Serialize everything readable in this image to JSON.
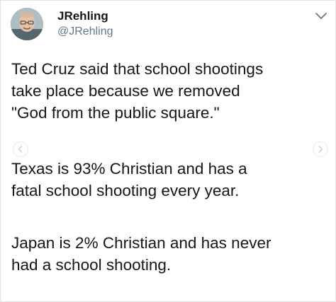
{
  "tweet": {
    "author_name": "JRehling",
    "author_handle": "@JRehling",
    "paragraphs": [
      [
        "Ted Cruz said that school shootings",
        "take place because we removed",
        "\"God from the public square.\""
      ],
      [
        "Texas is 93% Christian and has a",
        "fatal school shooting every year."
      ],
      [
        "Japan is 2% Christian and has never",
        "had a school shooting."
      ]
    ]
  },
  "icons": {
    "menu": "chevron-down-icon",
    "prev": "chevron-left-icon",
    "next": "chevron-right-icon"
  },
  "colors": {
    "text": "#14171a",
    "secondary": "#657786",
    "border": "#dfe3e6"
  }
}
